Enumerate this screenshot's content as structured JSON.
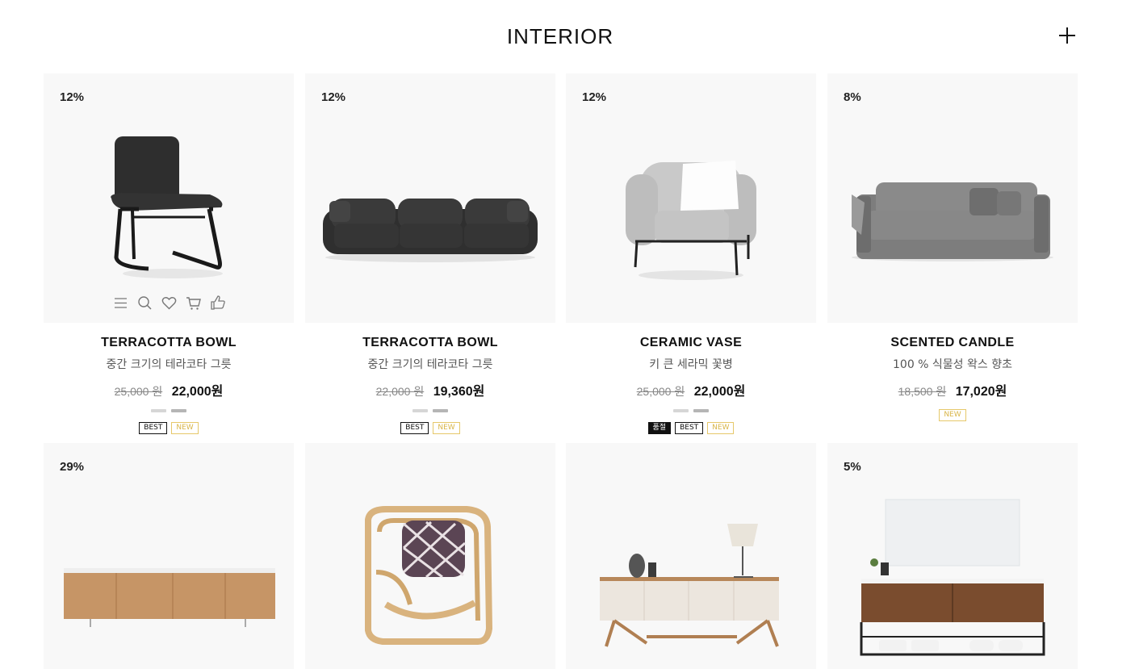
{
  "section": {
    "title": "INTERIOR",
    "more_icon": "plus-icon"
  },
  "colors": {
    "card_bg": "#f8f8f8",
    "badge_new": "#d9b64a",
    "badge_best": "#111111"
  },
  "hover_actions": [
    "menu-icon",
    "search-icon",
    "heart-icon",
    "cart-icon",
    "thumbs-up-icon"
  ],
  "products": [
    {
      "discount": "12%",
      "image": "dining-chair",
      "name": "TERRACOTTA BOWL",
      "desc": "중간 크기의 테라코타 그릇",
      "old_price": "25,000 원",
      "price": "22,000원",
      "swatches": [
        "#d6d6d6",
        "#b5b5b5"
      ],
      "badges": [
        "BEST",
        "NEW"
      ]
    },
    {
      "discount": "12%",
      "image": "dark-sofa",
      "name": "TERRACOTTA BOWL",
      "desc": "중간 크기의 테라코타 그릇",
      "old_price": "22,000 원",
      "price": "19,360원",
      "swatches": [
        "#d6d6d6",
        "#b5b5b5"
      ],
      "badges": [
        "BEST",
        "NEW"
      ]
    },
    {
      "discount": "12%",
      "image": "armchair",
      "name": "CERAMIC VASE",
      "desc": "키 큰 세라믹 꽃병",
      "old_price": "25,000 원",
      "price": "22,000원",
      "swatches": [
        "#d6d6d6",
        "#b5b5b5"
      ],
      "badges": [
        "품절",
        "BEST",
        "NEW"
      ]
    },
    {
      "discount": "8%",
      "image": "grey-sofa",
      "name": "SCENTED CANDLE",
      "desc": "100 % 식물성 왁스 향초",
      "old_price": "18,500 원",
      "price": "17,020원",
      "swatches": [],
      "badges": [
        "NEW"
      ]
    },
    {
      "discount": "29%",
      "image": "wood-sideboard"
    },
    {
      "discount": "",
      "image": "rattan-chair"
    },
    {
      "discount": "",
      "image": "white-console"
    },
    {
      "discount": "5%",
      "image": "bathroom-vanity"
    }
  ]
}
